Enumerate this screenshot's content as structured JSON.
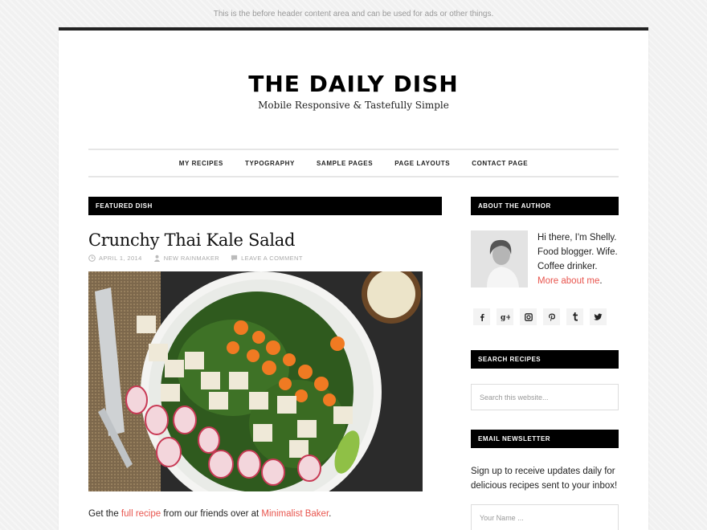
{
  "before_header": "This is the before header content area and can be used for ads or other things.",
  "site": {
    "title": "THE DAILY DISH",
    "tagline": "Mobile Responsive & Tastefully Simple"
  },
  "nav": [
    "MY RECIPES",
    "TYPOGRAPHY",
    "SAMPLE PAGES",
    "PAGE LAYOUTS",
    "CONTACT PAGE"
  ],
  "featured": {
    "section_title": "FEATURED DISH",
    "post_title": "Crunchy Thai Kale Salad",
    "date": "APRIL 1, 2014",
    "author": "NEW RAINMAKER",
    "comment": "LEAVE A COMMENT",
    "excerpt": {
      "pre": "Get the ",
      "link1": "full recipe",
      "mid": " from our friends over at ",
      "link2": "Minimalist Baker",
      "post": "."
    }
  },
  "sidebar": {
    "about_title": "ABOUT THE AUTHOR",
    "bio_lines": [
      "Hi there, I'm Shelly.",
      "Food blogger. Wife.",
      "Coffee drinker."
    ],
    "bio_link": "More about me",
    "bio_link_end": ".",
    "social": [
      "f",
      "g+",
      "ig",
      "p",
      "t",
      "tw"
    ],
    "search_title": "SEARCH RECIPES",
    "search_placeholder": "Search this website...",
    "newsletter_title": "EMAIL NEWSLETTER",
    "newsletter_text": "Sign up to receive updates daily for delicious recipes sent to your inbox!",
    "name_placeholder": "Your Name ..."
  },
  "colors": {
    "accent": "#e8554e",
    "bar": "#000000"
  }
}
